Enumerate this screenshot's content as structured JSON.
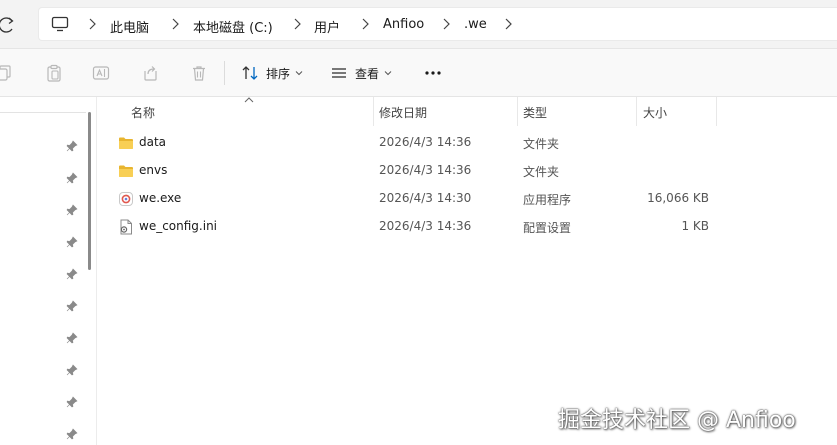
{
  "breadcrumb": {
    "items": [
      "此电脑",
      "本地磁盘 (C:)",
      "用户",
      "Anfioo",
      ".we"
    ]
  },
  "toolbar": {
    "sort_label": "排序",
    "view_label": "查看",
    "more_label": "..."
  },
  "columns": {
    "name": "名称",
    "date": "修改日期",
    "type": "类型",
    "size": "大小"
  },
  "files": [
    {
      "name": "data",
      "date": "2026/4/3 14:36",
      "type": "文件夹",
      "size": "",
      "icon": "folder-icon"
    },
    {
      "name": "envs",
      "date": "2026/4/3 14:36",
      "type": "文件夹",
      "size": "",
      "icon": "folder-icon"
    },
    {
      "name": "we.exe",
      "date": "2026/4/3 14:30",
      "type": "应用程序",
      "size": "16,066 KB",
      "icon": "exe-icon"
    },
    {
      "name": "we_config.ini",
      "date": "2026/4/3 14:36",
      "type": "配置设置",
      "size": "1 KB",
      "icon": "ini-file-icon"
    }
  ],
  "watermark": "掘金技术社区 @ Anfioo",
  "colors": {
    "folder": "#f4c542",
    "accent": "#0067c0"
  }
}
